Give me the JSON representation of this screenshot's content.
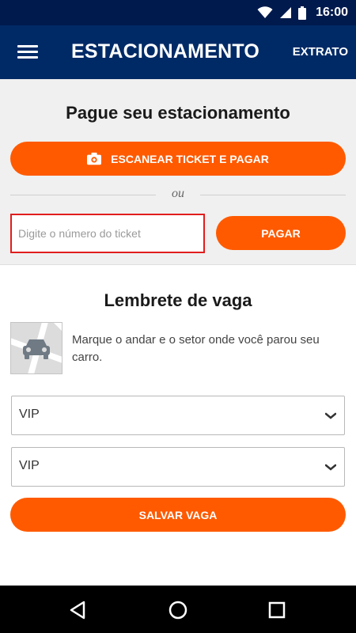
{
  "status_bar": {
    "time": "16:00"
  },
  "app_bar": {
    "title": "ESTACIONAMENTO",
    "extrato": "EXTRATO"
  },
  "pay": {
    "heading": "Pague seu estacionamento",
    "scan_button": "ESCANEAR TICKET E PAGAR",
    "divider": "ou",
    "ticket_placeholder": "Digite o número do ticket",
    "ticket_value": "",
    "pay_button": "PAGAR"
  },
  "reminder": {
    "heading": "Lembrete de vaga",
    "description": "Marque o andar e o setor onde você parou seu carro.",
    "floor_value": "VIP",
    "sector_value": "VIP",
    "save_button": "SALVAR VAGA"
  },
  "icons": {
    "status": [
      "wifi-icon",
      "signal-icon",
      "battery-icon"
    ],
    "app_bar": [
      "menu-icon"
    ],
    "buttons": [
      "camera-icon",
      "chevron-down-icon",
      "car-map-icon"
    ],
    "nav": [
      "back-icon",
      "home-icon",
      "recents-icon"
    ]
  },
  "colors": {
    "status_bar": "#001a4d",
    "app_bar": "#002a66",
    "accent": "#ff5a00",
    "input_error_border": "#e11d1d",
    "section_bg": "#f0f0f0"
  }
}
